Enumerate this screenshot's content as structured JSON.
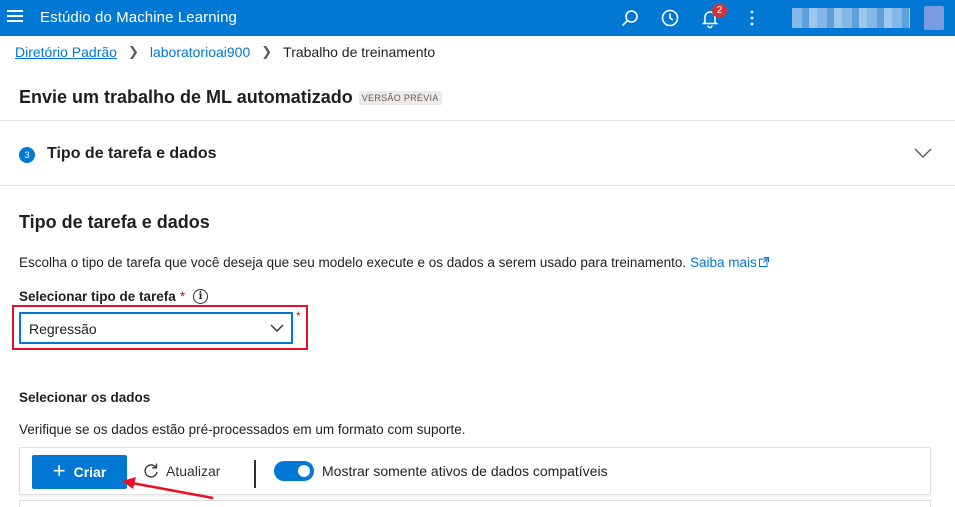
{
  "topbar": {
    "app_title": "Estúdio do Machine Learning",
    "notification_count": "2",
    "icons": [
      "menu-icon",
      "search-icon",
      "history-icon",
      "bell-icon",
      "more-icon"
    ]
  },
  "breadcrumb": {
    "items": [
      "Diretório Padrão",
      "laboratorioai900"
    ],
    "current": "Trabalho de treinamento"
  },
  "page": {
    "title": "Envie um trabalho de ML automatizado",
    "badge": "VERSÃO PRÉVIA"
  },
  "step": {
    "number": "3",
    "title": "Tipo de tarefa e dados"
  },
  "section": {
    "title": "Tipo de tarefa e dados",
    "description": "Escolha o tipo de tarefa que você deseja que seu modelo execute e os dados a serem usado para treinamento.",
    "learn_more": "Saiba mais"
  },
  "task_type": {
    "label": "Selecionar tipo de tarefa",
    "required_mark": "*",
    "value": "Regressão"
  },
  "data": {
    "title": "Selecionar os dados",
    "description": "Verifique se os dados estão pré-processados em um formato com suporte."
  },
  "toolbar": {
    "create_label": "Criar",
    "refresh_label": "Atualizar",
    "toggle_label": "Mostrar somente ativos de dados compatíveis",
    "toggle_on": true
  },
  "colors": {
    "accent": "#0078d4",
    "highlight": "#e81123"
  }
}
